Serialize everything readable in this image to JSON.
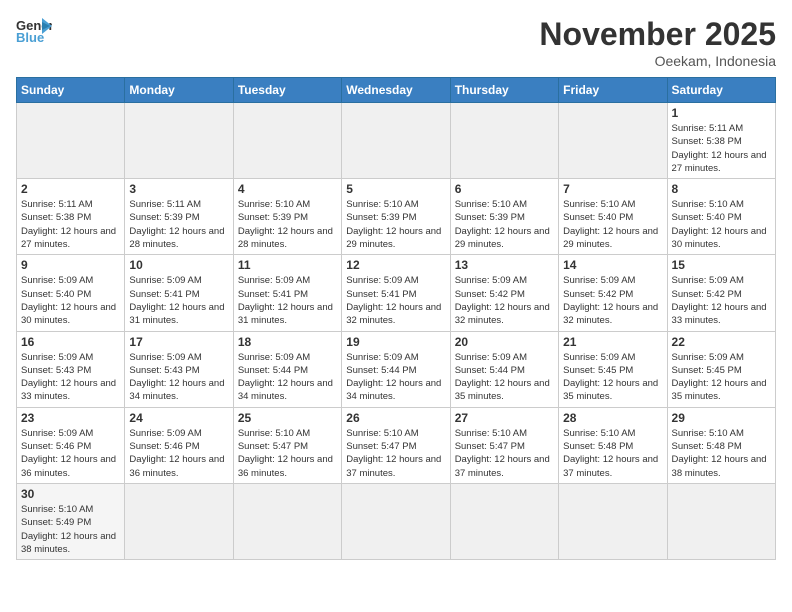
{
  "header": {
    "logo_general": "General",
    "logo_blue": "Blue",
    "month_title": "November 2025",
    "location": "Oeekam, Indonesia"
  },
  "weekdays": [
    "Sunday",
    "Monday",
    "Tuesday",
    "Wednesday",
    "Thursday",
    "Friday",
    "Saturday"
  ],
  "days": [
    {
      "num": "1",
      "sunrise": "5:11 AM",
      "sunset": "5:38 PM",
      "daylight": "12 hours and 27 minutes.",
      "col": 6
    },
    {
      "num": "2",
      "sunrise": "5:11 AM",
      "sunset": "5:38 PM",
      "daylight": "12 hours and 27 minutes.",
      "col": 0
    },
    {
      "num": "3",
      "sunrise": "5:11 AM",
      "sunset": "5:39 PM",
      "daylight": "12 hours and 28 minutes.",
      "col": 1
    },
    {
      "num": "4",
      "sunrise": "5:10 AM",
      "sunset": "5:39 PM",
      "daylight": "12 hours and 28 minutes.",
      "col": 2
    },
    {
      "num": "5",
      "sunrise": "5:10 AM",
      "sunset": "5:39 PM",
      "daylight": "12 hours and 29 minutes.",
      "col": 3
    },
    {
      "num": "6",
      "sunrise": "5:10 AM",
      "sunset": "5:39 PM",
      "daylight": "12 hours and 29 minutes.",
      "col": 4
    },
    {
      "num": "7",
      "sunrise": "5:10 AM",
      "sunset": "5:40 PM",
      "daylight": "12 hours and 29 minutes.",
      "col": 5
    },
    {
      "num": "8",
      "sunrise": "5:10 AM",
      "sunset": "5:40 PM",
      "daylight": "12 hours and 30 minutes.",
      "col": 6
    },
    {
      "num": "9",
      "sunrise": "5:09 AM",
      "sunset": "5:40 PM",
      "daylight": "12 hours and 30 minutes.",
      "col": 0
    },
    {
      "num": "10",
      "sunrise": "5:09 AM",
      "sunset": "5:41 PM",
      "daylight": "12 hours and 31 minutes.",
      "col": 1
    },
    {
      "num": "11",
      "sunrise": "5:09 AM",
      "sunset": "5:41 PM",
      "daylight": "12 hours and 31 minutes.",
      "col": 2
    },
    {
      "num": "12",
      "sunrise": "5:09 AM",
      "sunset": "5:41 PM",
      "daylight": "12 hours and 32 minutes.",
      "col": 3
    },
    {
      "num": "13",
      "sunrise": "5:09 AM",
      "sunset": "5:42 PM",
      "daylight": "12 hours and 32 minutes.",
      "col": 4
    },
    {
      "num": "14",
      "sunrise": "5:09 AM",
      "sunset": "5:42 PM",
      "daylight": "12 hours and 32 minutes.",
      "col": 5
    },
    {
      "num": "15",
      "sunrise": "5:09 AM",
      "sunset": "5:42 PM",
      "daylight": "12 hours and 33 minutes.",
      "col": 6
    },
    {
      "num": "16",
      "sunrise": "5:09 AM",
      "sunset": "5:43 PM",
      "daylight": "12 hours and 33 minutes.",
      "col": 0
    },
    {
      "num": "17",
      "sunrise": "5:09 AM",
      "sunset": "5:43 PM",
      "daylight": "12 hours and 34 minutes.",
      "col": 1
    },
    {
      "num": "18",
      "sunrise": "5:09 AM",
      "sunset": "5:44 PM",
      "daylight": "12 hours and 34 minutes.",
      "col": 2
    },
    {
      "num": "19",
      "sunrise": "5:09 AM",
      "sunset": "5:44 PM",
      "daylight": "12 hours and 34 minutes.",
      "col": 3
    },
    {
      "num": "20",
      "sunrise": "5:09 AM",
      "sunset": "5:44 PM",
      "daylight": "12 hours and 35 minutes.",
      "col": 4
    },
    {
      "num": "21",
      "sunrise": "5:09 AM",
      "sunset": "5:45 PM",
      "daylight": "12 hours and 35 minutes.",
      "col": 5
    },
    {
      "num": "22",
      "sunrise": "5:09 AM",
      "sunset": "5:45 PM",
      "daylight": "12 hours and 35 minutes.",
      "col": 6
    },
    {
      "num": "23",
      "sunrise": "5:09 AM",
      "sunset": "5:46 PM",
      "daylight": "12 hours and 36 minutes.",
      "col": 0
    },
    {
      "num": "24",
      "sunrise": "5:09 AM",
      "sunset": "5:46 PM",
      "daylight": "12 hours and 36 minutes.",
      "col": 1
    },
    {
      "num": "25",
      "sunrise": "5:10 AM",
      "sunset": "5:47 PM",
      "daylight": "12 hours and 36 minutes.",
      "col": 2
    },
    {
      "num": "26",
      "sunrise": "5:10 AM",
      "sunset": "5:47 PM",
      "daylight": "12 hours and 37 minutes.",
      "col": 3
    },
    {
      "num": "27",
      "sunrise": "5:10 AM",
      "sunset": "5:47 PM",
      "daylight": "12 hours and 37 minutes.",
      "col": 4
    },
    {
      "num": "28",
      "sunrise": "5:10 AM",
      "sunset": "5:48 PM",
      "daylight": "12 hours and 37 minutes.",
      "col": 5
    },
    {
      "num": "29",
      "sunrise": "5:10 AM",
      "sunset": "5:48 PM",
      "daylight": "12 hours and 38 minutes.",
      "col": 6
    },
    {
      "num": "30",
      "sunrise": "5:10 AM",
      "sunset": "5:49 PM",
      "daylight": "12 hours and 38 minutes.",
      "col": 0
    }
  ]
}
